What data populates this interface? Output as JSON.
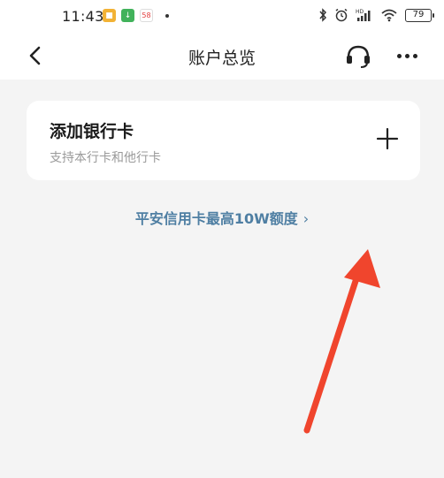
{
  "status_bar": {
    "time": "11:43",
    "battery": "79",
    "notification_icons": [
      "message-app-icon",
      "download-app-icon",
      "58-app-icon"
    ],
    "system_icons": [
      "bluetooth-icon",
      "alarm-icon",
      "hd-signal-icon",
      "wifi-icon",
      "battery-icon"
    ]
  },
  "nav": {
    "title": "账户总览",
    "back_icon": "chevron-left-icon",
    "service_icon": "headset-icon",
    "more_icon": "more-icon"
  },
  "card": {
    "title": "添加银行卡",
    "subtitle": "支持本行卡和他行卡",
    "action_icon": "plus-icon"
  },
  "promo": {
    "text": "平安信用卡最高10W额度",
    "chevron": "›"
  },
  "colors": {
    "background": "#f4f4f4",
    "promo_link": "#4f7fa3",
    "annotation_arrow": "#f0452d"
  }
}
